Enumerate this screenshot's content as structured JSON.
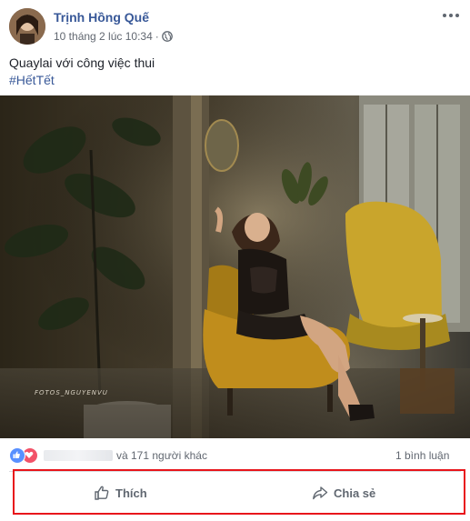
{
  "post": {
    "author": "Trịnh Hồng Quế",
    "timestamp": "10 tháng 2 lúc 10:34",
    "separator": "·",
    "text": "Quaylai với công việc thui",
    "hashtag": "#HếtTết",
    "photo_watermark": "FOTOS_NGUYENVU"
  },
  "stats": {
    "reaction_icons": [
      "like-icon",
      "love-icon"
    ],
    "others_text": "và 171 người khác",
    "comments": "1 bình luận"
  },
  "actions": {
    "like_label": "Thích",
    "share_label": "Chia sẻ"
  },
  "colors": {
    "name_link": "#385898",
    "highlight_border": "#e8151b",
    "like_blue": "#5890ff",
    "love_red": "#f25268"
  }
}
